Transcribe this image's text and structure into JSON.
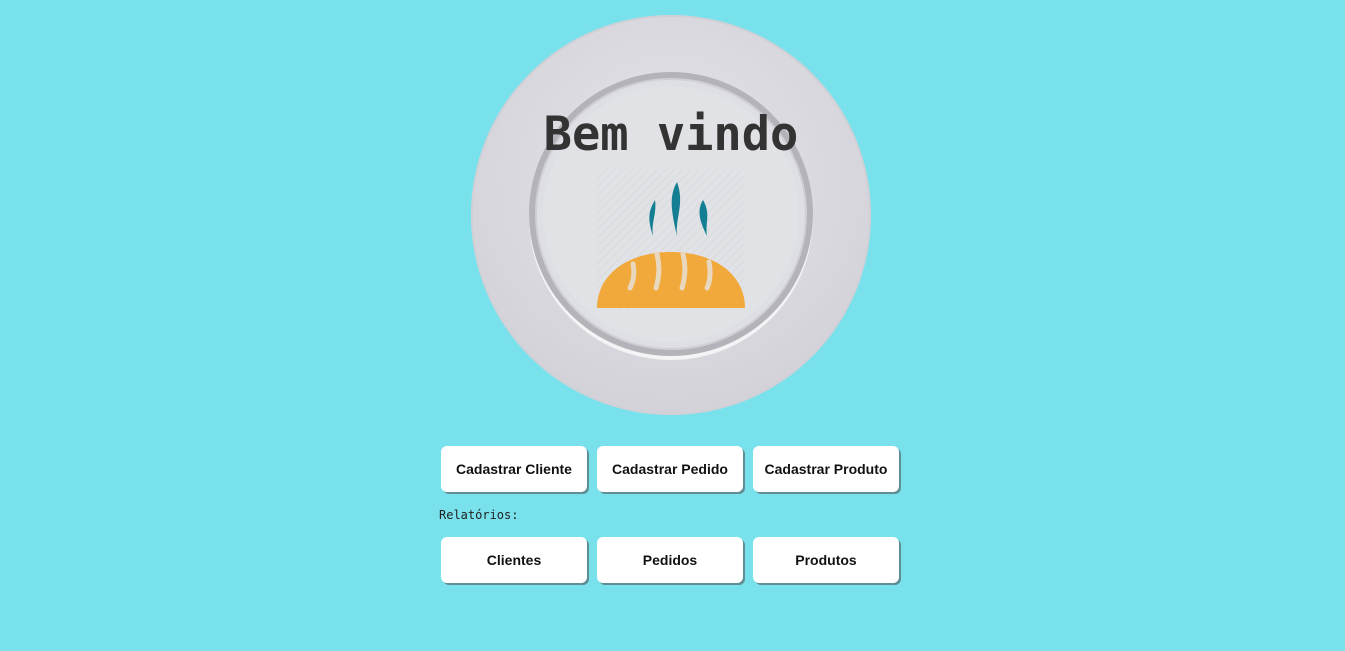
{
  "welcome": {
    "title": "Bem vindo"
  },
  "actions": {
    "cadastrar_cliente": "Cadastrar Cliente",
    "cadastrar_pedido": "Cadastrar Pedido",
    "cadastrar_produto": "Cadastrar Produto"
  },
  "reports": {
    "label": "Relatórios:",
    "clientes": "Clientes",
    "pedidos": "Pedidos",
    "produtos": "Produtos"
  },
  "colors": {
    "background": "#78e1ec",
    "bread": "#f2a93b",
    "steam": "#147f92",
    "title": "#333333"
  }
}
